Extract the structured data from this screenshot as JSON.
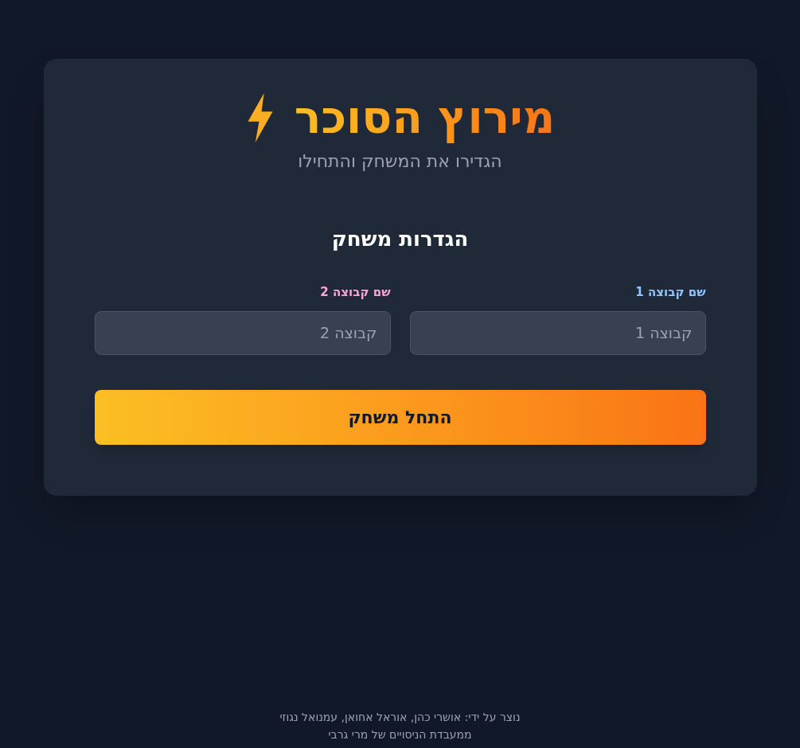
{
  "title": "מירוץ הסוכר",
  "subtitle": "הגדירו את המשחק והתחילו",
  "settings": {
    "heading": "הגדרות משחק",
    "fields": [
      {
        "label": "שם קבוצה 1",
        "placeholder": "קבוצה 1",
        "color": "#93c5fd"
      },
      {
        "label": "שם קבוצה 2",
        "placeholder": "קבוצה 2",
        "color": "#f9a8d4"
      }
    ],
    "start_button": "התחל משחק"
  },
  "footer": [
    "נוצר על ידי: אושרי כהן, אוראל אחואן, עמנואל נגוזי",
    "ממעבדת הניסויים של מרי גרבי"
  ]
}
